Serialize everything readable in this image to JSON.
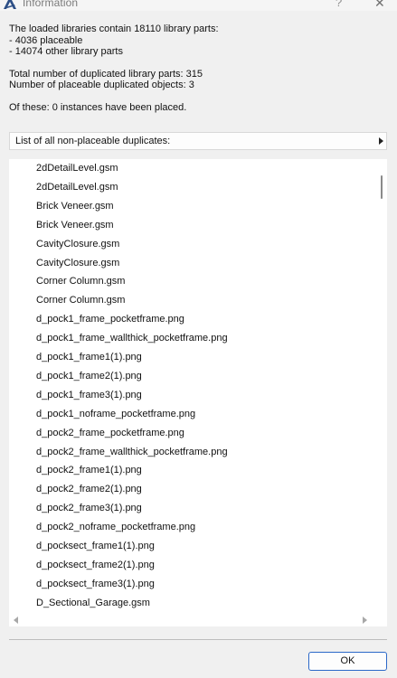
{
  "window": {
    "title": "Information",
    "help_glyph": "?",
    "close_glyph": "✕"
  },
  "info": {
    "line1": "The loaded libraries contain 18110 library parts:",
    "line2": "- 4036 placeable",
    "line3": "- 14074 other library parts",
    "line4": "Total number of duplicated library parts: 315",
    "line5": "Number of placeable duplicated objects: 3",
    "line6": "Of these: 0 instances have been placed."
  },
  "list": {
    "header_label": "List of all non-placeable duplicates:",
    "items": [
      "2dDetailLevel.gsm",
      "2dDetailLevel.gsm",
      "Brick Veneer.gsm",
      "Brick Veneer.gsm",
      "CavityClosure.gsm",
      "CavityClosure.gsm",
      "Corner Column.gsm",
      "Corner Column.gsm",
      "d_pock1_frame_pocketframe.png",
      "d_pock1_frame_wallthick_pocketframe.png",
      "d_pock1_frame1(1).png",
      "d_pock1_frame2(1).png",
      "d_pock1_frame3(1).png",
      "d_pock1_noframe_pocketframe.png",
      "d_pock2_frame_pocketframe.png",
      "d_pock2_frame_wallthick_pocketframe.png",
      "d_pock2_frame1(1).png",
      "d_pock2_frame2(1).png",
      "d_pock2_frame3(1).png",
      "d_pock2_noframe_pocketframe.png",
      "d_pocksect_frame1(1).png",
      "d_pocksect_frame2(1).png",
      "d_pocksect_frame3(1).png",
      "D_Sectional_Garage.gsm"
    ]
  },
  "buttons": {
    "ok_label": "OK"
  },
  "colors": {
    "window_bg": "#f0f0f0",
    "list_bg": "#ffffff",
    "ok_border": "#2b68c8"
  }
}
